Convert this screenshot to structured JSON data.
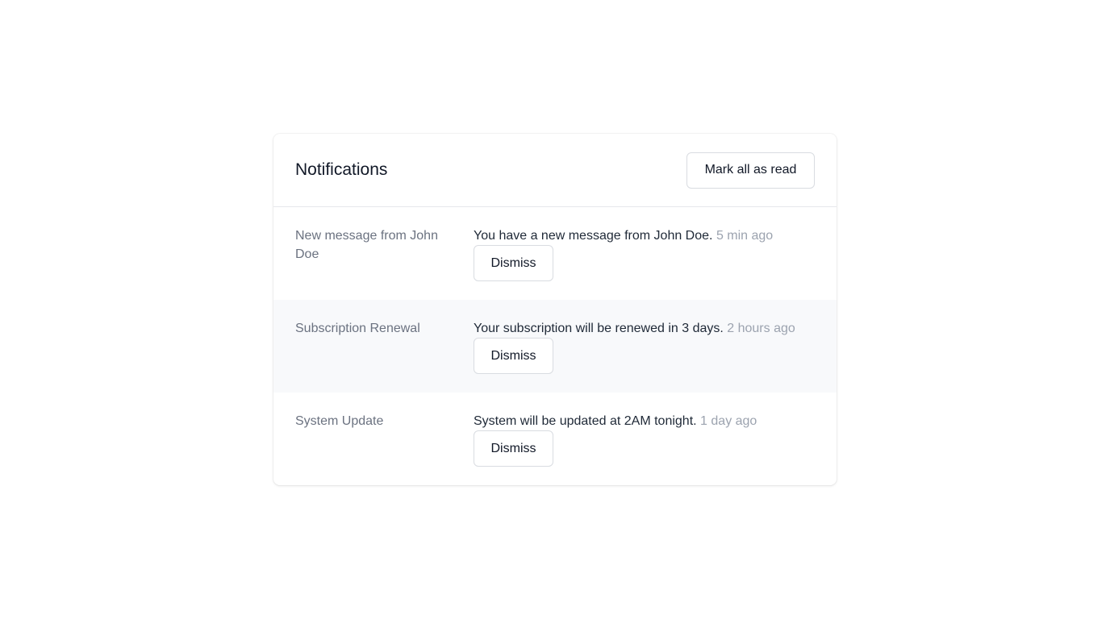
{
  "header": {
    "title": "Notifications",
    "mark_all_label": "Mark all as read"
  },
  "notifications": [
    {
      "title": "New message from John Doe",
      "message": "You have a new message from John Doe.",
      "time": "5 min ago",
      "dismiss_label": "Dismiss"
    },
    {
      "title": "Subscription Renewal",
      "message": "Your subscription will be renewed in 3 days.",
      "time": "2 hours ago",
      "dismiss_label": "Dismiss"
    },
    {
      "title": "System Update",
      "message": "System will be updated at 2AM tonight.",
      "time": "1 day ago",
      "dismiss_label": "Dismiss"
    }
  ]
}
